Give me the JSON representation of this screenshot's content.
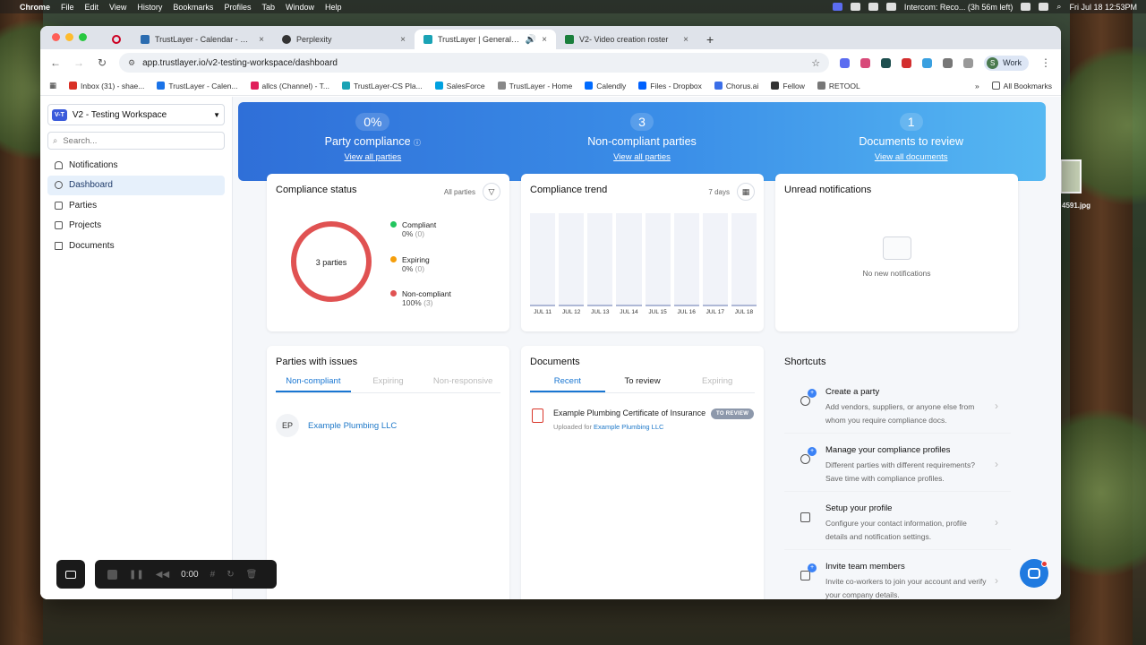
{
  "menubar": {
    "app": "Chrome",
    "menus": [
      "File",
      "Edit",
      "View",
      "History",
      "Bookmarks",
      "Profiles",
      "Tab",
      "Window",
      "Help"
    ],
    "intercom": "Intercom: Reco... (3h 56m left)",
    "datetime": "Fri Jul 18  12:53PM"
  },
  "desktop": {
    "file_label": "4591.jpg"
  },
  "browser": {
    "tabs": [
      {
        "label": "TrustLayer - Calendar - Week"
      },
      {
        "label": "Perplexity"
      },
      {
        "label": "TrustLayer | General settin"
      },
      {
        "label": "V2- Video creation roster"
      }
    ],
    "url": "app.trustlayer.io/v2-testing-workspace/dashboard",
    "profile": {
      "initial": "S",
      "name": "Work"
    },
    "bookmarks": [
      "Inbox (31) - shae...",
      "TrustLayer - Calen...",
      "allcs (Channel) - T...",
      "TrustLayer-CS Pla...",
      "SalesForce",
      "TrustLayer - Home",
      "Calendly",
      "Files - Dropbox",
      "Chorus.ai",
      "Fellow",
      "RETOOL"
    ],
    "all_bookmarks": "All Bookmarks"
  },
  "sidebar": {
    "workspace_badge": "V-T",
    "workspace_name": "V2 - Testing Workspace",
    "search_placeholder": "Search...",
    "items": [
      {
        "label": "Notifications",
        "icon": "bell-icon"
      },
      {
        "label": "Dashboard",
        "icon": "dashboard-icon"
      },
      {
        "label": "Parties",
        "icon": "parties-icon"
      },
      {
        "label": "Projects",
        "icon": "projects-icon"
      },
      {
        "label": "Documents",
        "icon": "documents-icon"
      }
    ]
  },
  "hero": {
    "stats": [
      {
        "value": "0%",
        "label": "Party compliance",
        "link": "View all parties"
      },
      {
        "value": "3",
        "label": "Non-compliant parties",
        "link": "View all parties"
      },
      {
        "value": "1",
        "label": "Documents to review",
        "link": "View all documents"
      }
    ]
  },
  "compliance_status": {
    "title": "Compliance status",
    "filter": "All parties",
    "center_label": "3 parties",
    "legend": [
      {
        "name": "Compliant",
        "pct": "0%",
        "count": "(0)",
        "color": "#22c55e"
      },
      {
        "name": "Expiring",
        "pct": "0%",
        "count": "(0)",
        "color": "#f59e0b"
      },
      {
        "name": "Non-compliant",
        "pct": "100%",
        "count": "(3)",
        "color": "#e05252"
      }
    ]
  },
  "compliance_trend": {
    "title": "Compliance trend",
    "range": "7 days",
    "days": [
      "JUL 11",
      "JUL 12",
      "JUL 13",
      "JUL 14",
      "JUL 15",
      "JUL 16",
      "JUL 17",
      "JUL 18"
    ]
  },
  "notifications": {
    "title": "Unread notifications",
    "empty": "No new notifications"
  },
  "parties_issues": {
    "title": "Parties with issues",
    "tabs": [
      "Non-compliant",
      "Expiring",
      "Non-responsive"
    ],
    "rows": [
      {
        "initials": "EP",
        "name": "Example Plumbing LLC"
      }
    ]
  },
  "documents": {
    "title": "Documents",
    "tabs": [
      "Recent",
      "To review",
      "Expiring"
    ],
    "rows": [
      {
        "name": "Example Plumbing Certificate of Insurance",
        "uploaded_prefix": "Uploaded for",
        "party": "Example Plumbing LLC",
        "status": "TO REVIEW"
      }
    ]
  },
  "shortcuts": {
    "title": "Shortcuts",
    "items": [
      {
        "title": "Create a party",
        "desc": "Add vendors, suppliers, or anyone else from whom you require compliance docs."
      },
      {
        "title": "Manage your compliance profiles",
        "desc": "Different parties with different requirements? Save time with compliance profiles."
      },
      {
        "title": "Setup your profile",
        "desc": "Configure your contact information, profile details and notification settings."
      },
      {
        "title": "Invite team members",
        "desc": "Invite co-workers to join your account and verify your company details."
      }
    ]
  },
  "recorder": {
    "time": "0:00"
  }
}
